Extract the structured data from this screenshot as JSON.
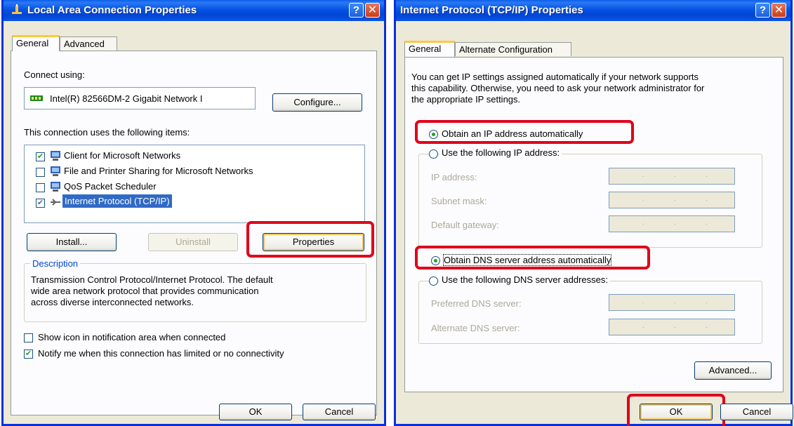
{
  "left_dialog": {
    "title": "Local Area Connection Properties",
    "tabs": [
      "General",
      "Advanced"
    ],
    "connect_using_label": "Connect using:",
    "adapter": "Intel(R) 82566DM-2 Gigabit Network I",
    "configure_label": "Configure...",
    "items_label": "This connection uses the following items:",
    "items": [
      {
        "label": "Client for Microsoft Networks",
        "checked": true
      },
      {
        "label": "File and Printer Sharing for Microsoft Networks",
        "checked": false
      },
      {
        "label": "QoS Packet Scheduler",
        "checked": false
      },
      {
        "label": "Internet Protocol (TCP/IP)",
        "checked": true,
        "selected": true
      }
    ],
    "install_label": "Install...",
    "uninstall_label": "Uninstall",
    "properties_label": "Properties",
    "description_heading": "Description",
    "description_lines": [
      "Transmission Control Protocol/Internet Protocol. The default",
      "wide area network protocol that provides communication",
      "across diverse interconnected networks."
    ],
    "show_icon_label": "Show icon in notification area when connected",
    "notify_label": "Notify me when this connection has limited or no connectivity",
    "ok_label": "OK",
    "cancel_label": "Cancel"
  },
  "right_dialog": {
    "title": "Internet Protocol (TCP/IP) Properties",
    "tabs": [
      "General",
      "Alternate Configuration"
    ],
    "intro_lines": [
      "You can get IP settings assigned automatically if your network supports",
      "this capability. Otherwise, you need to ask your network administrator for",
      "the appropriate IP settings."
    ],
    "obtain_ip_label": "Obtain an IP address automatically",
    "use_ip_label": "Use the following IP address:",
    "ip_address_label": "IP address:",
    "subnet_mask_label": "Subnet mask:",
    "gateway_label": "Default gateway:",
    "obtain_dns_label": "Obtain DNS server address automatically",
    "use_dns_label": "Use the following DNS server addresses:",
    "preferred_dns_label": "Preferred DNS server:",
    "alternate_dns_label": "Alternate DNS server:",
    "advanced_label": "Advanced...",
    "ok_label": "OK",
    "cancel_label": "Cancel"
  },
  "colors": {
    "title_bar": "#0054E3",
    "dialog_bg": "#ECE9D8",
    "highlight_box": "#E0001B",
    "selection": "#316AC5"
  }
}
